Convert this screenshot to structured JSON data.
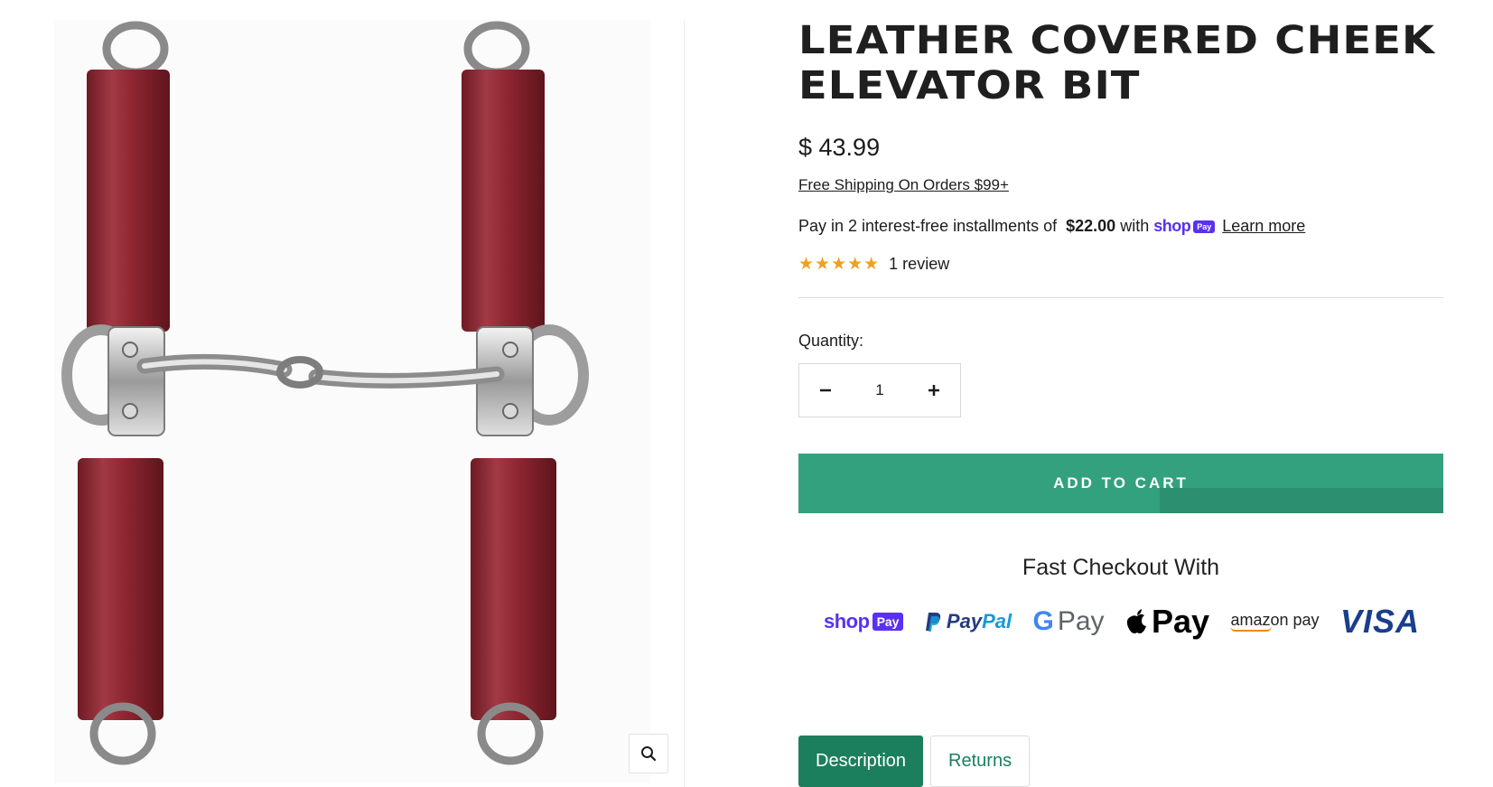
{
  "product": {
    "title": "LEATHER COVERED CHEEK ELEVATOR BIT",
    "price": "$ 43.99",
    "shipping_link": "Free Shipping On Orders $99+",
    "installments": {
      "prefix": "Pay in 2 interest-free installments of",
      "amount": "$22.00",
      "suffix": "with",
      "provider_word": "shop",
      "provider_chip": "Pay",
      "learn_more": "Learn more"
    },
    "rating": {
      "stars": "★★★★★",
      "value": 5,
      "max": 5,
      "review_text": "1 review"
    }
  },
  "quantity": {
    "label": "Quantity:",
    "value": "1",
    "decrement": "−",
    "increment": "+"
  },
  "cart": {
    "add_label": "ADD TO CART"
  },
  "checkout": {
    "title": "Fast Checkout With",
    "methods": {
      "shop_word": "shop",
      "shop_chip": "Pay",
      "paypal_a": "Pay",
      "paypal_b": "Pal",
      "gpay_g": "G",
      "gpay_text": "Pay",
      "apple_glyph": "",
      "apple_text": "Pay",
      "amazon_text": "amazon pay",
      "visa_text": "VISA"
    }
  },
  "tabs": [
    {
      "label": "Description",
      "active": true
    },
    {
      "label": "Returns",
      "active": false
    }
  ],
  "gallery": {
    "zoom_icon": "zoom-icon",
    "image": "leather-covered-cheek-elevator-bit"
  },
  "colors": {
    "accent": "#33a07e",
    "tab_active": "#1b7f5d",
    "shop_purple": "#5a31f4",
    "leather_red": "#8e2631",
    "star": "#f0a020"
  }
}
